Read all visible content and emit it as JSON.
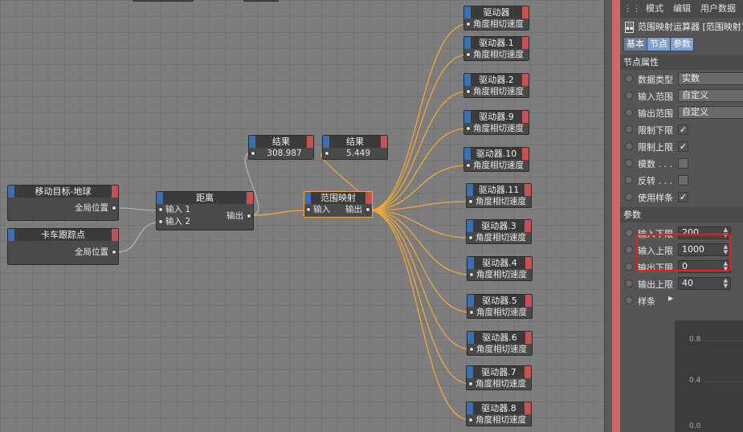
{
  "colors": {
    "wire": "#f0a838",
    "wire_gray": "#b0b0b0",
    "highlight": "#e8201c"
  },
  "nodes": {
    "move_target": {
      "title": "移动目标-地球",
      "port": "全局位置"
    },
    "truck_track": {
      "title": "卡车跟踪点",
      "port": "全局位置"
    },
    "distance": {
      "title": "距离",
      "in1": "输入 1",
      "in2": "输入 2",
      "out": "输出"
    },
    "result1": {
      "title": "结果",
      "value": "308.987"
    },
    "result2": {
      "title": "结果",
      "value": "5.449"
    },
    "range_mapper": {
      "title": "范围映射",
      "in": "输入",
      "out": "输出"
    },
    "drivers": [
      {
        "title": "驱动器",
        "port": "角度相切速度"
      },
      {
        "title": "驱动器.1",
        "port": "角度相切速度"
      },
      {
        "title": "驱动器.2",
        "port": "角度相切速度"
      },
      {
        "title": "驱动器.9",
        "port": "角度相切速度"
      },
      {
        "title": "驱动器.10",
        "port": "角度相切速度"
      },
      {
        "title": "驱动器.11",
        "port": "角度相切速度"
      },
      {
        "title": "驱动器.3",
        "port": "角度相切速度"
      },
      {
        "title": "驱动器.4",
        "port": "角度相切速度"
      },
      {
        "title": "驱动器.5",
        "port": "角度相切速度"
      },
      {
        "title": "驱动器.6",
        "port": "角度相切速度"
      },
      {
        "title": "驱动器.7",
        "port": "角度相切速度"
      },
      {
        "title": "驱动器.8",
        "port": "角度相切速度"
      }
    ]
  },
  "panel": {
    "menu": [
      "模式",
      "编辑",
      "用户数据"
    ],
    "object_title": "范围映射运算器 [范围映射]",
    "tabs": [
      "基本",
      "节点",
      "参数"
    ],
    "node_props_header": "节点属性",
    "props": [
      {
        "label": "数据类型",
        "value": "实数"
      },
      {
        "label": "输入范围",
        "value": "自定义"
      },
      {
        "label": "输出范围",
        "value": "自定义"
      }
    ],
    "checks": [
      {
        "label": "限制下限",
        "checked": "✓"
      },
      {
        "label": "限制上限",
        "checked": "✓"
      },
      {
        "label": "模数 . . .",
        "checked": ""
      },
      {
        "label": "反转 . . .",
        "checked": ""
      },
      {
        "label": "使用样条",
        "checked": "✓"
      }
    ],
    "params_header": "参数",
    "params": [
      {
        "label": "输入下限",
        "value": "200"
      },
      {
        "label": "输入上限",
        "value": "1000"
      },
      {
        "label": "输出下限",
        "value": "0"
      },
      {
        "label": "输出上限",
        "value": "40"
      }
    ],
    "spline_label": "样条",
    "graph_ticks": [
      "0.8",
      "0.4",
      "0.0"
    ]
  }
}
